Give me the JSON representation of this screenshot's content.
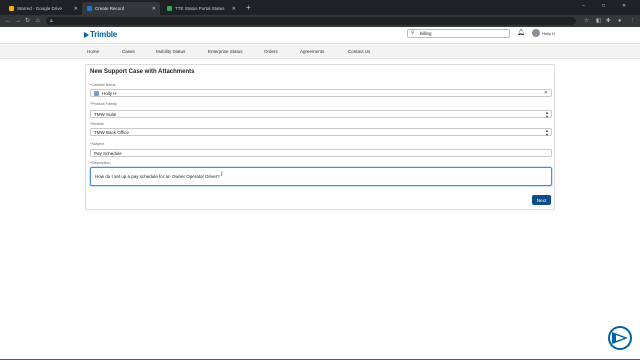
{
  "browser": {
    "tabs": [
      {
        "title": "Starred - Google Drive",
        "icon_color": "#f4b400",
        "active": false
      },
      {
        "title": "Create Record",
        "icon_color": "#1f77c9",
        "active": true
      },
      {
        "title": "TTE Status Portal Status",
        "icon_color": "#34a853",
        "active": false
      }
    ],
    "new_tab": "+",
    "window_controls": {
      "minimize": "–",
      "maximize": "□",
      "close": "✕"
    }
  },
  "site": {
    "logo_text": "Trimble",
    "search_value": "billing",
    "user_name": "Holly H"
  },
  "nav": {
    "items": [
      "Home",
      "Cases",
      "Mobility Status",
      "Enterprise Status",
      "Orders",
      "Agreements",
      "Contact Us"
    ]
  },
  "form": {
    "title": "New Support Case with Attachments",
    "contact_name_label": "Contact Name",
    "contact_name_value": "Holly H",
    "product_family_label": "Product Family",
    "product_family_value": "TMW Suite",
    "module_label": "Module",
    "module_value": "TMW Back Office",
    "subject_label": "Subject",
    "subject_value": "Pay Schedule",
    "description_label": "Description",
    "description_value": "How do I set up a pay schedule for an Owner Operator Driver?",
    "required_marker": "*",
    "next_label": "Next"
  },
  "colors": {
    "brand": "#0063a3",
    "button": "#0d4e8a",
    "focus": "#4a8fd6"
  }
}
